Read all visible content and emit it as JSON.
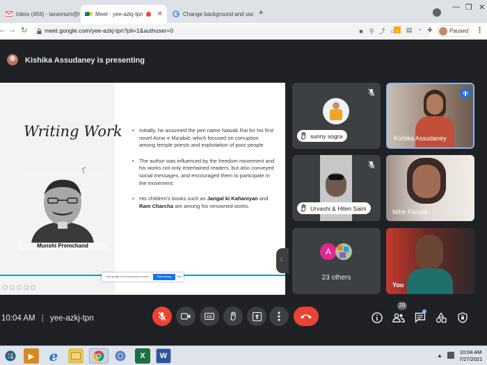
{
  "browser": {
    "tabs": [
      {
        "label": "Inbox (456) - tarannum@theindi...",
        "favicon": "gmail-icon"
      },
      {
        "label": "Meet - yee-azkj-tpn",
        "favicon": "meet-icon",
        "active": true
      },
      {
        "label": "Change background and use eff...",
        "favicon": "google-icon"
      }
    ],
    "new_tab_label": "+",
    "url": "meet.google.com/yee-azkj-tpn?pli=1&authuser=0",
    "profile_label": "Paused"
  },
  "meet": {
    "presenter_text": "Kishika Assudaney is presenting",
    "slide": {
      "title": "Writing Work",
      "caption": "Munshi Premchand",
      "bullets": [
        {
          "text": "Initially, he assumed the pen name Nawab Rai for his first novel Asrar e Ma'abid, which focused on corruption among temple priests and exploitation of poor people"
        },
        {
          "text": "The author was influenced by the freedom movement and his works not only entertained readers, but also conveyed social messages, and encouraged them to participate in the movement."
        },
        {
          "prefix": "His children's books such as ",
          "bold1": "Jangal ki Kahaniyan",
          "mid": " and ",
          "bold2": "Ram Charcha",
          "suffix": " are among his renowned works."
        }
      ],
      "share_banner": {
        "text": "meet.google.com is sharing your screen.",
        "stop_label": "Stop sharing",
        "hide_label": "Hide"
      }
    },
    "tiles": [
      {
        "name": "sunny sogra",
        "style": "pill"
      },
      {
        "name": "Kishika Assudaney",
        "style": "plain"
      },
      {
        "name": "Urvashi & Hiten Saini",
        "style": "pill"
      },
      {
        "name": "Mihir Pareek",
        "style": "plain"
      },
      {
        "name": "23 others",
        "avatar_letter": "A"
      },
      {
        "name": "You",
        "style": "plain"
      }
    ],
    "time": "10:04 AM",
    "meeting_code": "yee-azkj-tpn",
    "participant_count": "29",
    "colors": {
      "end_call": "#ea4335",
      "mic_off": "#ea4335",
      "accent": "#8ab4f8"
    }
  },
  "taskbar": {
    "apps": [
      "windows-start-icon",
      "media-player-icon",
      "edge-icon",
      "file-explorer-icon",
      "chrome-icon",
      "chrome-canary-icon",
      "excel-icon",
      "word-icon"
    ],
    "clock_time": "10:04 AM",
    "clock_date": "7/27/2021"
  }
}
